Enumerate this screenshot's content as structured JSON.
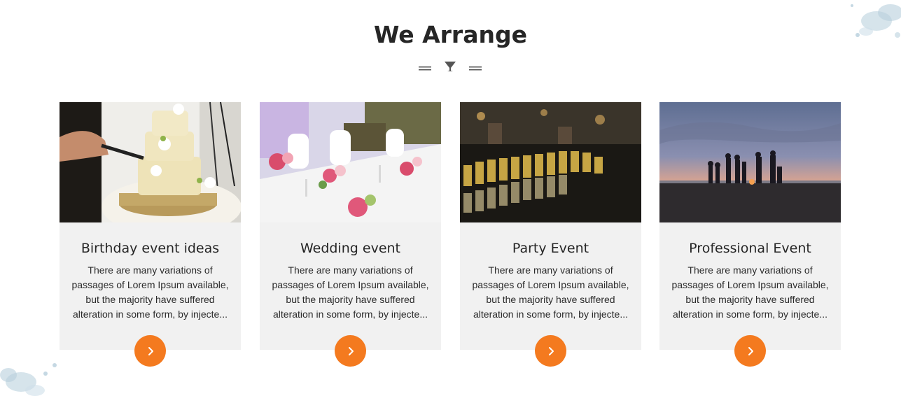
{
  "section": {
    "title": "We Arrange"
  },
  "icons": {
    "divider_icon": "cocktail-glass-icon",
    "button_icon": "chevron-right-icon"
  },
  "colors": {
    "accent": "#f47a1f",
    "card_bg": "#f1f1f1",
    "title": "#262626"
  },
  "cards": [
    {
      "title": "Birthday event ideas",
      "text": "There are many variations of passages of Lorem Ipsum available, but the majority have suffered alteration in some form, by injecte...",
      "image": "wedding-cake-photo"
    },
    {
      "title": "Wedding event",
      "text": "There are many variations of passages of Lorem Ipsum available, but the majority have suffered alteration in some form, by injecte...",
      "image": "wedding-table-photo"
    },
    {
      "title": "Party Event",
      "text": "There are many variations of passages of Lorem Ipsum available, but the majority have suffered alteration in some form, by injecte...",
      "image": "champagne-glasses-photo"
    },
    {
      "title": "Professional Event",
      "text": "There are many variations of passages of Lorem Ipsum available, but the majority have suffered alteration in some form, by injecte...",
      "image": "beach-sunset-photo"
    }
  ]
}
